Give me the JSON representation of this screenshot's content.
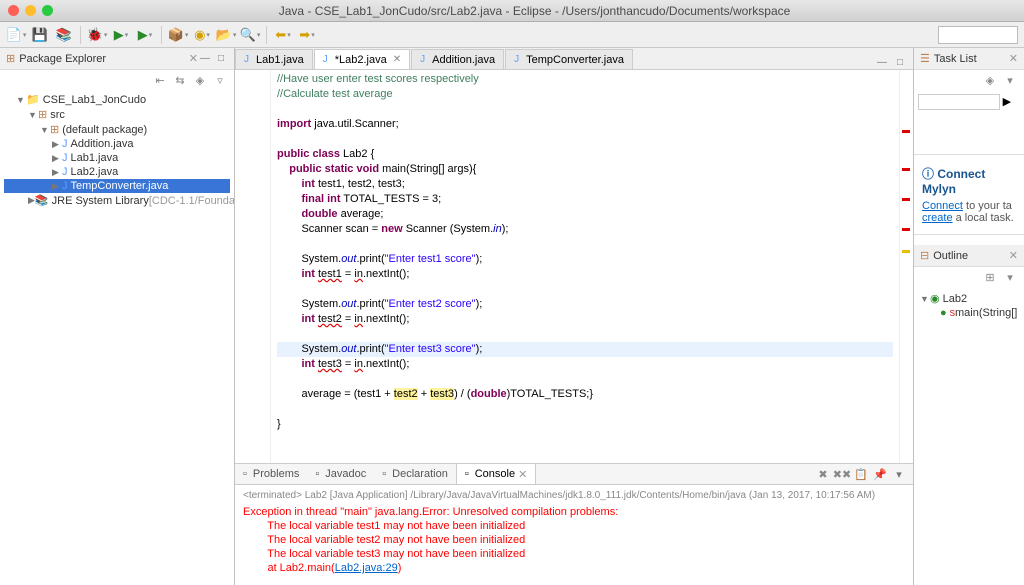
{
  "window": {
    "title": "Java - CSE_Lab1_JonCudo/src/Lab2.java - Eclipse - /Users/jonthancudo/Documents/workspace"
  },
  "package_explorer": {
    "title": "Package Explorer",
    "project": "CSE_Lab1_JonCudo",
    "src": "src",
    "pkg": "(default package)",
    "files": [
      "Addition.java",
      "Lab1.java",
      "Lab2.java",
      "TempConverter.java"
    ],
    "jre": "JRE System Library",
    "jre_suffix": "[CDC-1.1/Founda"
  },
  "editor_tabs": [
    {
      "label": "Lab1.java",
      "dirty": false
    },
    {
      "label": "*Lab2.java",
      "dirty": true,
      "active": true
    },
    {
      "label": "Addition.java",
      "dirty": false
    },
    {
      "label": "TempConverter.java",
      "dirty": false
    }
  ],
  "code_lines": [
    {
      "t": "//Have user enter test scores respectively",
      "cls": "cm"
    },
    {
      "t": "//Calculate test average",
      "cls": "cm"
    },
    {
      "t": ""
    },
    {
      "html": "<span class='kw'>import</span> java.util.Scanner;"
    },
    {
      "t": ""
    },
    {
      "html": "<span class='kw'>public class</span> Lab2 {"
    },
    {
      "html": "    <span class='kw'>public static void</span> main(String[] args){"
    },
    {
      "html": "        <span class='kw'>int</span> test1, test2, test3;"
    },
    {
      "html": "        <span class='kw'>final int</span> TOTAL_TESTS = 3;"
    },
    {
      "html": "        <span class='kw'>double</span> average;"
    },
    {
      "html": "        Scanner scan = <span class='kw'>new</span> Scanner (System.<span class='fld'>in</span>);"
    },
    {
      "t": ""
    },
    {
      "html": "        System.<span class='fld'>out</span>.print(<span class='str'>\"Enter test1 score\"</span>);"
    },
    {
      "html": "        <span class='kw'>int</span> <span class='err'>test1</span> = <span class='err'>in</span>.nextInt();"
    },
    {
      "t": ""
    },
    {
      "html": "        System.<span class='fld'>out</span>.print(<span class='str'>\"Enter test2 score\"</span>);"
    },
    {
      "html": "        <span class='kw'>int</span> <span class='err'>test2</span> = <span class='err'>in</span>.nextInt();"
    },
    {
      "t": ""
    },
    {
      "html": "        System.<span class='fld'>out</span>.print(<span class='str'>\"Enter test3 score\"</span>);",
      "hl": true
    },
    {
      "html": "        <span class='kw'>int</span> <span class='err'>test3</span> = <span class='err'>in</span>.nextInt();"
    },
    {
      "t": ""
    },
    {
      "html": "        average = (test1 + <span class='warn'>test2</span> + <span class='warn'>test3</span>) / (<span class='kw'>double</span>)TOTAL_TESTS;}"
    },
    {
      "t": ""
    },
    {
      "t": "}"
    }
  ],
  "bottom_tabs": [
    {
      "label": "Problems"
    },
    {
      "label": "Javadoc"
    },
    {
      "label": "Declaration"
    },
    {
      "label": "Console",
      "active": true
    }
  ],
  "console": {
    "header": "<terminated> Lab2 [Java Application] /Library/Java/JavaVirtualMachines/jdk1.8.0_111.jdk/Contents/Home/bin/java (Jan 13, 2017, 10:17:56 AM)",
    "lines": [
      "Exception in thread \"main\" java.lang.Error: Unresolved compilation problems: ",
      "        The local variable test1 may not have been initialized",
      "        The local variable test2 may not have been initialized",
      "        The local variable test3 may not have been initialized",
      "",
      "        at Lab2.main("
    ],
    "link": "Lab2.java:29",
    "after": ")"
  },
  "task_list": {
    "title": "Task List"
  },
  "mylyn": {
    "title": "Connect Mylyn",
    "text1": "Connect",
    "text2": " to your ta",
    "text3": "create",
    "text4": " a local task."
  },
  "outline": {
    "title": "Outline",
    "root": "Lab2",
    "method": "main(String[]"
  }
}
